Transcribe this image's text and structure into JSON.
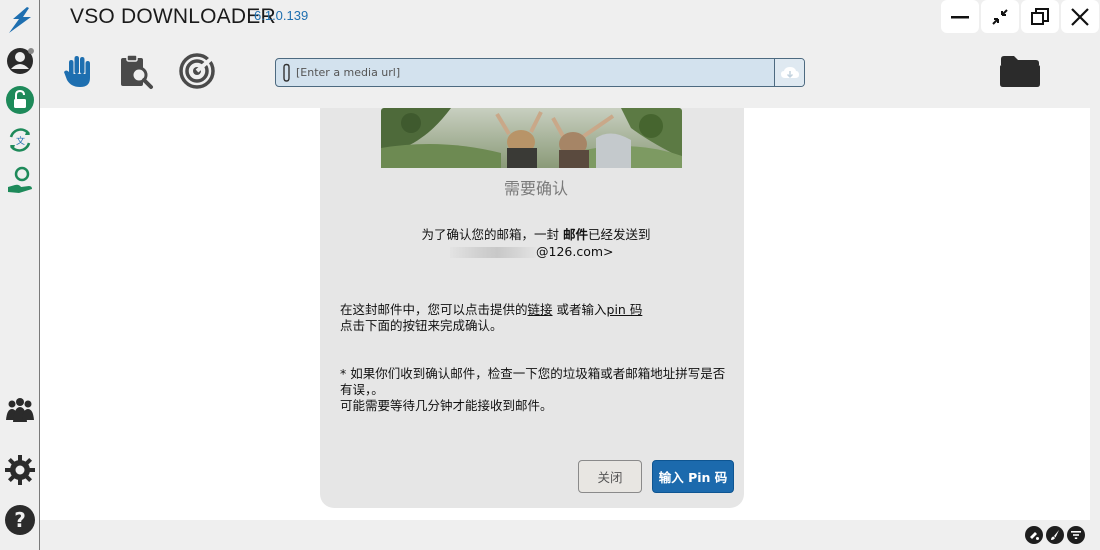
{
  "app": {
    "title": "VSO DOWNLOADER",
    "version": "6.1.0.139"
  },
  "window_controls": [
    "minimize-icon",
    "collapse-icon",
    "restore-icon",
    "close-icon"
  ],
  "sidebar": {
    "top": [
      "downloads-arrow-icon",
      "account-icon",
      "unlock-icon",
      "translate-refresh-icon",
      "donate-hand-icon"
    ],
    "bottom": [
      "community-icon",
      "settings-icon",
      "help-icon"
    ]
  },
  "toolbar": {
    "tools": [
      "stop-hand-icon",
      "clipboard-search-icon",
      "record-icon"
    ],
    "url_placeholder": "[Enter a media url]"
  },
  "dialog": {
    "title": "需要确认",
    "line1_prefix": "为了确认您的邮箱，一封",
    "line1_bold": "邮件",
    "line1_suffix": "已经发送到",
    "email_suffix": "@126.com>",
    "body_a": "在这封邮件中，您可以点击提供的",
    "link_text": "链接",
    "body_b": " 或者输入",
    "pin_text": "pin 码",
    "body_c": "点击下面的按钮来完成确认。",
    "note1": "* 如果你们收到确认邮件，检查一下您的垃圾箱或者邮箱地址拼写是否有误，。",
    "note2": "可能需要等待几分钟才能接收到邮件。",
    "close_label": "关闭",
    "pin_label": "输入 Pin 码"
  },
  "colors": {
    "accent": "#1c6aad",
    "sidebar_green": "#1e8a5a",
    "hand_blue": "#1e6fb0"
  }
}
